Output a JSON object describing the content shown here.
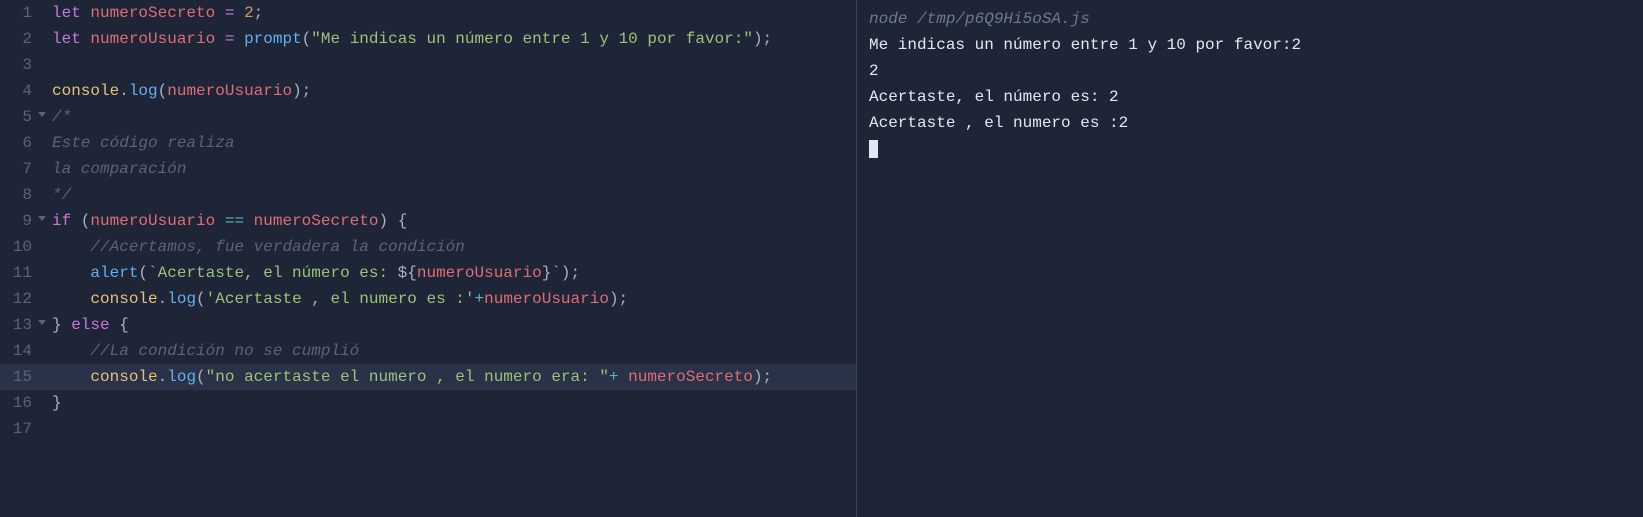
{
  "editor": {
    "lines": [
      {
        "num": "1",
        "fold": false,
        "hl": false,
        "tokens": [
          {
            "t": "let ",
            "c": "tok-declaration"
          },
          {
            "t": "numeroSecreto",
            "c": "tok-variable"
          },
          {
            "t": " ",
            "c": "tok-default"
          },
          {
            "t": "=",
            "c": "tok-assign"
          },
          {
            "t": " ",
            "c": "tok-default"
          },
          {
            "t": "2",
            "c": "tok-number"
          },
          {
            "t": ";",
            "c": "tok-punct"
          }
        ]
      },
      {
        "num": "2",
        "fold": false,
        "hl": false,
        "tokens": [
          {
            "t": "let ",
            "c": "tok-declaration"
          },
          {
            "t": "numeroUsuario",
            "c": "tok-variable"
          },
          {
            "t": " ",
            "c": "tok-default"
          },
          {
            "t": "=",
            "c": "tok-assign"
          },
          {
            "t": " ",
            "c": "tok-default"
          },
          {
            "t": "prompt",
            "c": "tok-function"
          },
          {
            "t": "(",
            "c": "tok-punct"
          },
          {
            "t": "\"Me indicas un número entre 1 y 10 por favor:\"",
            "c": "tok-string"
          },
          {
            "t": ");",
            "c": "tok-punct"
          }
        ]
      },
      {
        "num": "3",
        "fold": false,
        "hl": false,
        "tokens": []
      },
      {
        "num": "4",
        "fold": false,
        "hl": false,
        "tokens": [
          {
            "t": "console",
            "c": "tok-object"
          },
          {
            "t": ".",
            "c": "tok-punct"
          },
          {
            "t": "log",
            "c": "tok-function"
          },
          {
            "t": "(",
            "c": "tok-punct"
          },
          {
            "t": "numeroUsuario",
            "c": "tok-variable"
          },
          {
            "t": ");",
            "c": "tok-punct"
          }
        ]
      },
      {
        "num": "5",
        "fold": true,
        "hl": false,
        "tokens": [
          {
            "t": "/*",
            "c": "tok-comment"
          }
        ]
      },
      {
        "num": "6",
        "fold": false,
        "hl": false,
        "tokens": [
          {
            "t": "Este código realiza",
            "c": "tok-comment"
          }
        ]
      },
      {
        "num": "7",
        "fold": false,
        "hl": false,
        "tokens": [
          {
            "t": "la comparación",
            "c": "tok-comment"
          }
        ]
      },
      {
        "num": "8",
        "fold": false,
        "hl": false,
        "tokens": [
          {
            "t": "*/",
            "c": "tok-comment"
          }
        ]
      },
      {
        "num": "9",
        "fold": true,
        "hl": false,
        "tokens": [
          {
            "t": "if",
            "c": "tok-keyword"
          },
          {
            "t": " (",
            "c": "tok-punct"
          },
          {
            "t": "numeroUsuario",
            "c": "tok-variable"
          },
          {
            "t": " ",
            "c": "tok-default"
          },
          {
            "t": "==",
            "c": "tok-operator"
          },
          {
            "t": " ",
            "c": "tok-default"
          },
          {
            "t": "numeroSecreto",
            "c": "tok-variable"
          },
          {
            "t": ") {",
            "c": "tok-punct"
          }
        ]
      },
      {
        "num": "10",
        "fold": false,
        "hl": false,
        "tokens": [
          {
            "t": "    ",
            "c": "tok-default"
          },
          {
            "t": "//Acertamos, fue verdadera la condición",
            "c": "tok-comment"
          }
        ]
      },
      {
        "num": "11",
        "fold": false,
        "hl": false,
        "tokens": [
          {
            "t": "    ",
            "c": "tok-default"
          },
          {
            "t": "alert",
            "c": "tok-function"
          },
          {
            "t": "(",
            "c": "tok-punct"
          },
          {
            "t": "`Acertaste, el número es: ",
            "c": "tok-template"
          },
          {
            "t": "${",
            "c": "tok-punct"
          },
          {
            "t": "numeroUsuario",
            "c": "tok-interp"
          },
          {
            "t": "}",
            "c": "tok-punct"
          },
          {
            "t": "`",
            "c": "tok-template"
          },
          {
            "t": ");",
            "c": "tok-punct"
          }
        ]
      },
      {
        "num": "12",
        "fold": false,
        "hl": false,
        "tokens": [
          {
            "t": "    ",
            "c": "tok-default"
          },
          {
            "t": "console",
            "c": "tok-object"
          },
          {
            "t": ".",
            "c": "tok-punct"
          },
          {
            "t": "log",
            "c": "tok-function"
          },
          {
            "t": "(",
            "c": "tok-punct"
          },
          {
            "t": "'Acertaste , el numero es :'",
            "c": "tok-string"
          },
          {
            "t": "+",
            "c": "tok-operator"
          },
          {
            "t": "numeroUsuario",
            "c": "tok-variable"
          },
          {
            "t": ");",
            "c": "tok-punct"
          }
        ]
      },
      {
        "num": "13",
        "fold": true,
        "hl": false,
        "tokens": [
          {
            "t": "} ",
            "c": "tok-punct"
          },
          {
            "t": "else",
            "c": "tok-keyword"
          },
          {
            "t": " {",
            "c": "tok-punct"
          }
        ]
      },
      {
        "num": "14",
        "fold": false,
        "hl": false,
        "tokens": [
          {
            "t": "    ",
            "c": "tok-default"
          },
          {
            "t": "//La condición no se cumplió",
            "c": "tok-comment"
          }
        ]
      },
      {
        "num": "15",
        "fold": false,
        "hl": true,
        "tokens": [
          {
            "t": "    ",
            "c": "tok-default"
          },
          {
            "t": "console",
            "c": "tok-object"
          },
          {
            "t": ".",
            "c": "tok-punct"
          },
          {
            "t": "log",
            "c": "tok-function"
          },
          {
            "t": "(",
            "c": "tok-punct"
          },
          {
            "t": "\"no acertaste el numero , el numero era: \"",
            "c": "tok-string"
          },
          {
            "t": "+ ",
            "c": "tok-operator"
          },
          {
            "t": "numeroSecreto",
            "c": "tok-variable"
          },
          {
            "t": ");",
            "c": "tok-punct"
          }
        ]
      },
      {
        "num": "16",
        "fold": false,
        "hl": false,
        "tokens": [
          {
            "t": "}",
            "c": "tok-punct"
          }
        ]
      },
      {
        "num": "17",
        "fold": false,
        "hl": false,
        "tokens": []
      }
    ]
  },
  "output": {
    "command": "node /tmp/p6Q9Hi5oSA.js",
    "lines": [
      "Me indicas un número entre 1 y 10 por favor:2",
      "2",
      "Acertaste, el número es: 2",
      "Acertaste , el numero es :2"
    ]
  }
}
